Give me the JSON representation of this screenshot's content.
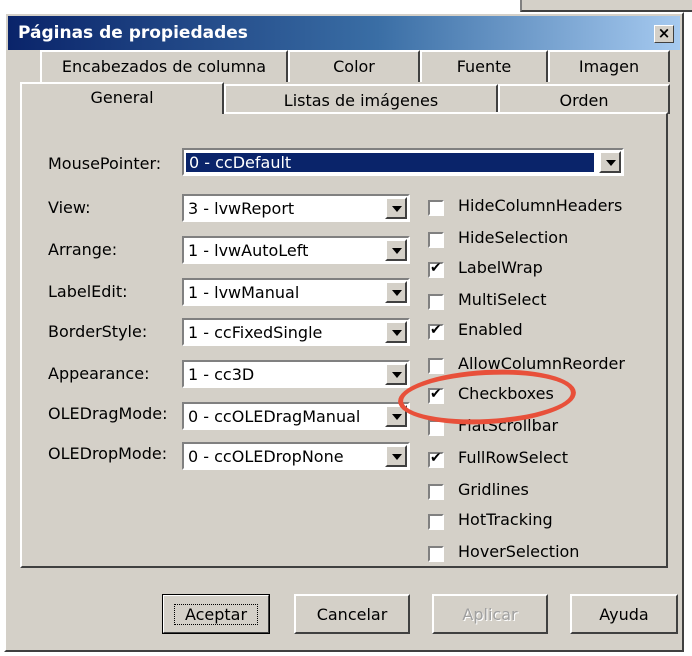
{
  "window": {
    "title": "Páginas de propiedades",
    "close_label": "×"
  },
  "tabs": {
    "back_row": [
      "Encabezados de columna",
      "Color",
      "Fuente",
      "Imagen"
    ],
    "front_row": [
      "General",
      "Listas de imágenes",
      "Orden"
    ],
    "active": "General"
  },
  "fields": [
    {
      "label": "MousePointer:",
      "value": "0 - ccDefault"
    },
    {
      "label": "View:",
      "value": "3 - lvwReport"
    },
    {
      "label": "Arrange:",
      "value": "1 - lvwAutoLeft"
    },
    {
      "label": "LabelEdit:",
      "value": "1 - lvwManual"
    },
    {
      "label": "BorderStyle:",
      "value": "1 - ccFixedSingle"
    },
    {
      "label": "Appearance:",
      "value": "1 - cc3D"
    },
    {
      "label": "OLEDragMode:",
      "value": "0 - ccOLEDragManual"
    },
    {
      "label": "OLEDropMode:",
      "value": "0 - ccOLEDropNone"
    }
  ],
  "checkboxes": [
    {
      "label": "HideColumnHeaders",
      "checked": false
    },
    {
      "label": "HideSelection",
      "checked": false
    },
    {
      "label": "LabelWrap",
      "checked": true
    },
    {
      "label": "MultiSelect",
      "checked": false
    },
    {
      "label": "Enabled",
      "checked": true
    },
    {
      "label": "AllowColumnReorder",
      "checked": false
    },
    {
      "label": "Checkboxes",
      "checked": true
    },
    {
      "label": "FlatScrollbar",
      "checked": false
    },
    {
      "label": "FullRowSelect",
      "checked": true
    },
    {
      "label": "Gridlines",
      "checked": false
    },
    {
      "label": "HotTracking",
      "checked": false
    },
    {
      "label": "HoverSelection",
      "checked": false
    }
  ],
  "buttons": {
    "ok": "Aceptar",
    "cancel": "Cancelar",
    "apply": "Aplicar",
    "help": "Ayuda"
  },
  "colors": {
    "title_bar": "#0a246a",
    "dialog_face": "#d4d0c8",
    "annotation": "#e8503a"
  }
}
